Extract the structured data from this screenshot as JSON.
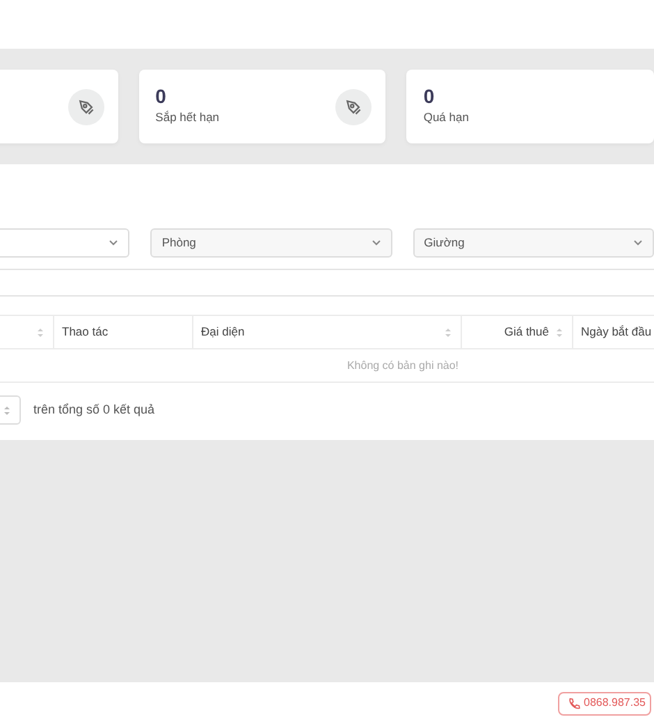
{
  "stats": [
    {
      "icon": true
    },
    {
      "value": "0",
      "label": "Sắp hết hạn",
      "icon": true
    },
    {
      "value": "0",
      "label": "Quá hạn"
    }
  ],
  "filters": [
    {
      "kind": "select"
    },
    {
      "kind": "select",
      "placeholder": "Phòng"
    },
    {
      "kind": "select",
      "placeholder": "Giường"
    }
  ],
  "table": {
    "columns": [
      {
        "kind": "text",
        "sortable": true
      },
      {
        "kind": "text",
        "label": "Thao tác",
        "sortable": false
      },
      {
        "kind": "text",
        "label": "Đại diện",
        "sortable": true
      },
      {
        "kind": "numeric",
        "label": "Giá thuê",
        "sortable": true
      },
      {
        "kind": "text",
        "label": "Ngày bắt đầu",
        "sortable": false
      }
    ],
    "empty_message": "Không có bản ghi nào!"
  },
  "pagination": {
    "summary": "trên tổng số 0 kết quả"
  },
  "footer": {
    "phone": "0868.987.35"
  }
}
